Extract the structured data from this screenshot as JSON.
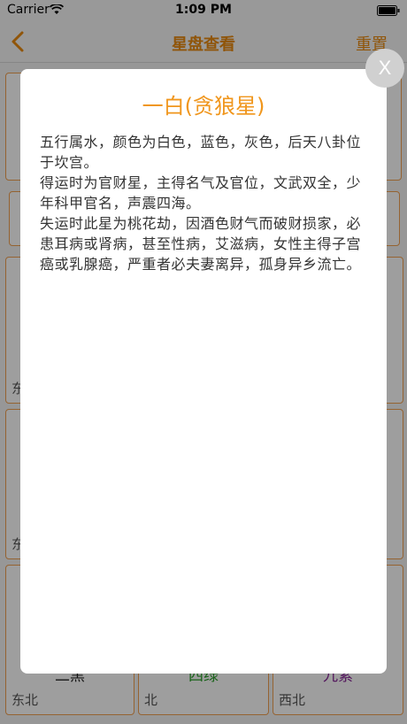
{
  "status_bar": {
    "carrier": "Carrier",
    "time": "1:09 PM"
  },
  "nav": {
    "title": "星盘查看",
    "reset_label": "重置"
  },
  "grid": {
    "cells": [
      {
        "dir": "东",
        "star": "",
        "color": "#222222"
      },
      {
        "dir": "东",
        "star": "",
        "color": "#222222"
      },
      {
        "dir": "东北",
        "star": "二黑",
        "color": "#222222"
      },
      {
        "dir": "北",
        "star": "四绿",
        "color": "#2aa02a"
      },
      {
        "dir": "西北",
        "star": "九紫",
        "color": "#8a2a9a"
      }
    ]
  },
  "modal": {
    "title": "一白(贪狼星)",
    "paragraphs": [
      "五行属水，颜色为白色，蓝色，灰色，后天八卦位于坎宫。",
      "得运时为官财星，主得名气及官位，文武双全，少年科甲官名，声震四海。",
      "失运时此星为桃花劫，因酒色财气而破财损家，必患耳病或肾病，甚至性病，艾滋病，女性主得子宫癌或乳腺癌，严重者必夫妻离异，孤身异乡流亡。"
    ],
    "close_label": "X"
  },
  "colors": {
    "accent": "#e88a10",
    "title_orange": "#f0961c"
  }
}
